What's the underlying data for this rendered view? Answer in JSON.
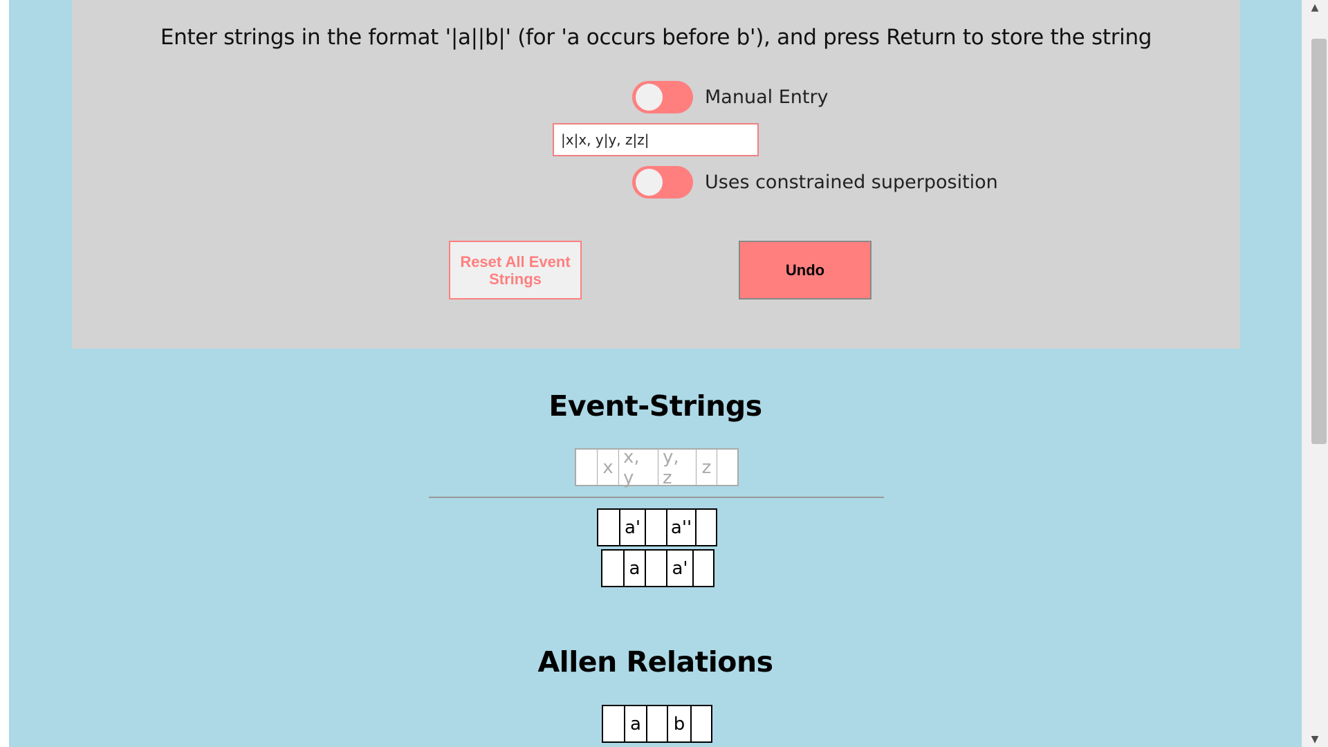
{
  "instructions": "Enter strings in the format '|a||b|' (for 'a occurs before b'), and press Return to store the string",
  "manual_entry_label": "Manual Entry",
  "input_value": "|x|x, y|y, z|z|",
  "constrained_label": "Uses constrained superposition",
  "reset_label": "Reset All Event Strings",
  "undo_label": "Undo",
  "event_strings_title": "Event-Strings",
  "preview_cells": [
    "",
    "x",
    "x, y",
    "y, z",
    "z",
    ""
  ],
  "stored_rows": [
    [
      "",
      "a'",
      "",
      "a''",
      ""
    ],
    [
      "",
      "a",
      "",
      "a'",
      ""
    ]
  ],
  "allen_title": "Allen Relations",
  "allen_rows": [
    [
      "",
      "a",
      "",
      "b",
      ""
    ]
  ],
  "colors": {
    "background": "#add8e6",
    "panel": "#d3d3d3",
    "accent": "#ff7f7f"
  }
}
